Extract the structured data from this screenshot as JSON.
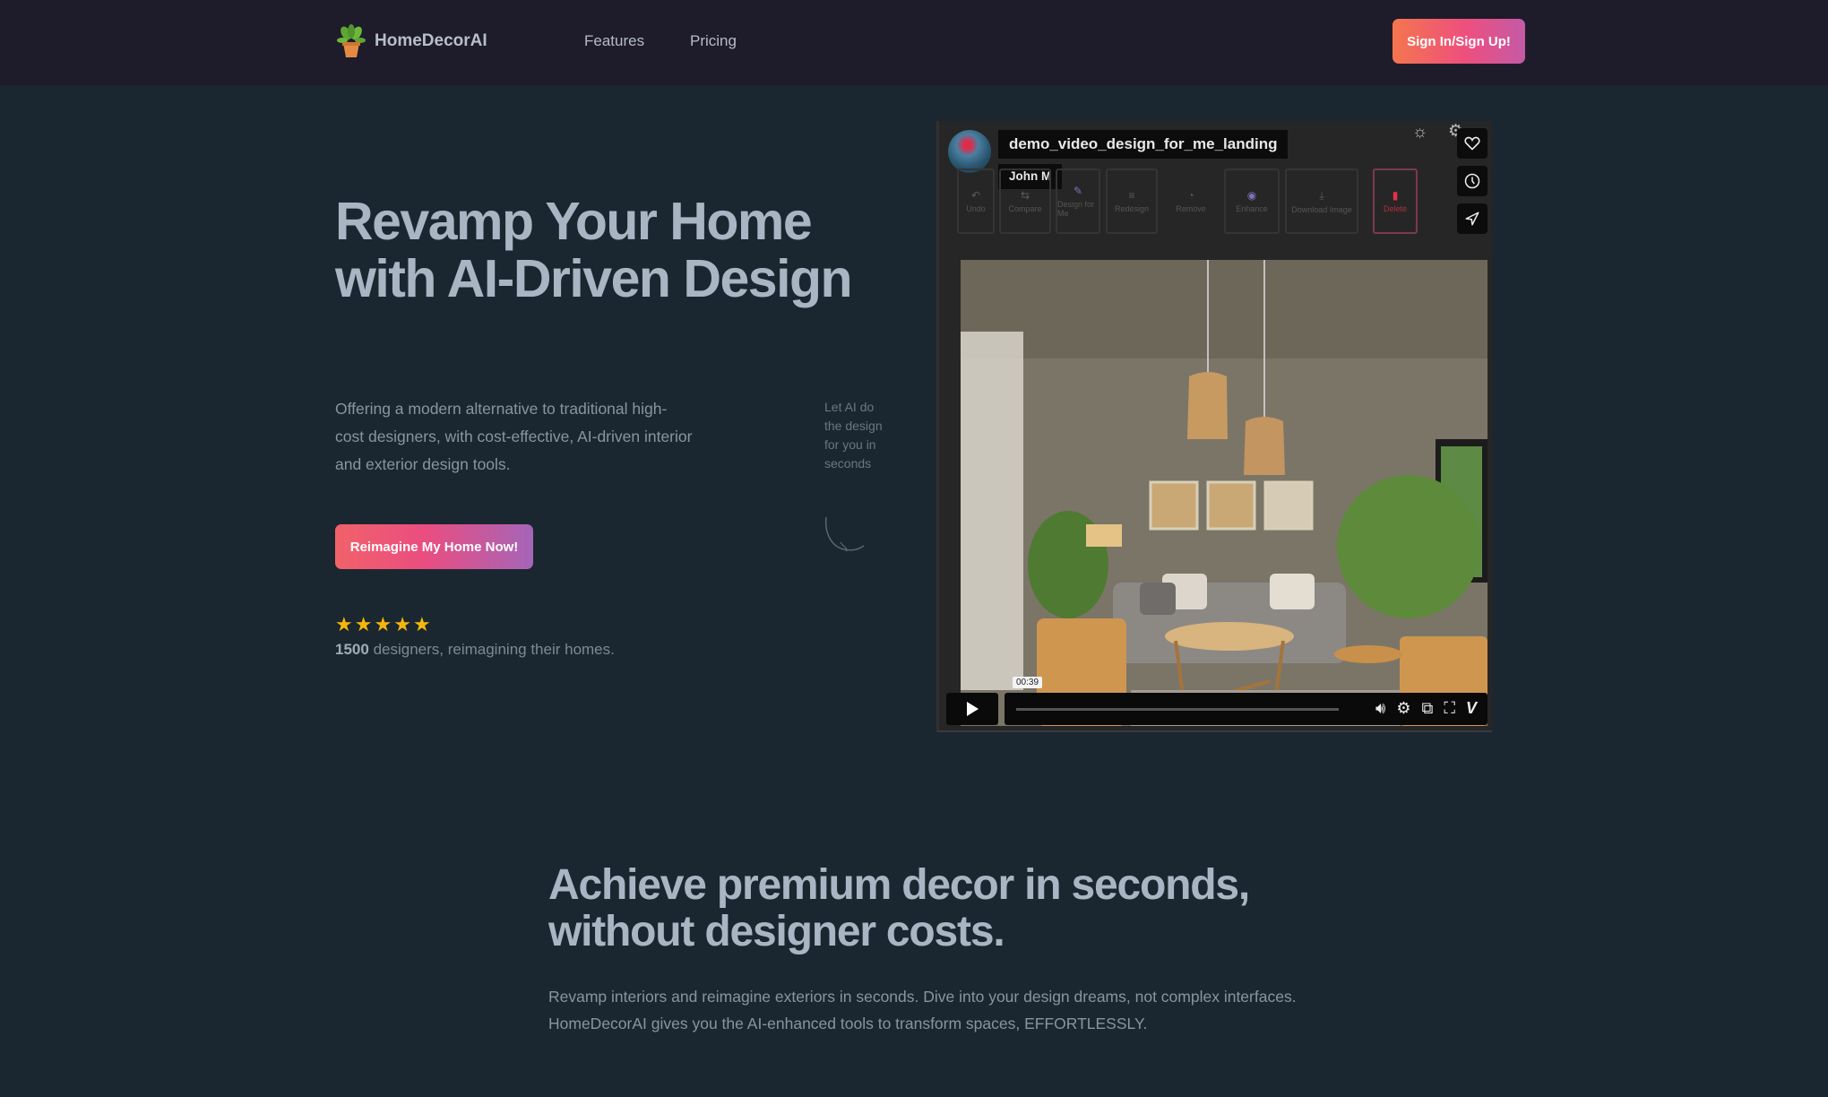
{
  "nav": {
    "brand": "HomeDecorAI",
    "links": [
      {
        "label": "Features"
      },
      {
        "label": "Pricing"
      }
    ],
    "signin_label": "Sign In/Sign Up!"
  },
  "hero": {
    "title": "Revamp Your Home with AI-Driven Design",
    "description": "Offering a modern alternative to traditional high-cost designers, with cost-effective, AI-driven interior and exterior design tools.",
    "cta_label": "Reimagine My Home Now!",
    "rating_stars": 5,
    "proof_count": "1500",
    "proof_text": "designers, reimagining their homes.",
    "side_note": "Let AI do the design for you in seconds"
  },
  "video": {
    "title": "demo_video_design_for_me_landing",
    "author": "John M",
    "tools": [
      {
        "label": "Undo",
        "icon": "undo-icon"
      },
      {
        "label": "Compare",
        "icon": "compare-icon"
      },
      {
        "label": "Design for Me",
        "icon": "wand-icon"
      },
      {
        "label": "Redesign",
        "icon": "redesign-icon"
      },
      {
        "label": "Remove",
        "icon": "remove-icon"
      },
      {
        "label": "Enhance",
        "icon": "enhance-icon"
      },
      {
        "label": "Download Image",
        "icon": "download-icon"
      },
      {
        "label": "Delete",
        "icon": "trash-icon"
      }
    ],
    "timestamp": "00:39",
    "accent_delete": "#e6304a"
  },
  "section2": {
    "title": "Achieve premium decor in seconds, without designer costs.",
    "description": "Revamp interiors and reimagine exteriors in seconds. Dive into your design dreams, not complex interfaces. HomeDecorAI gives you the AI-enhanced tools to transform spaces, EFFORTLESSLY."
  }
}
